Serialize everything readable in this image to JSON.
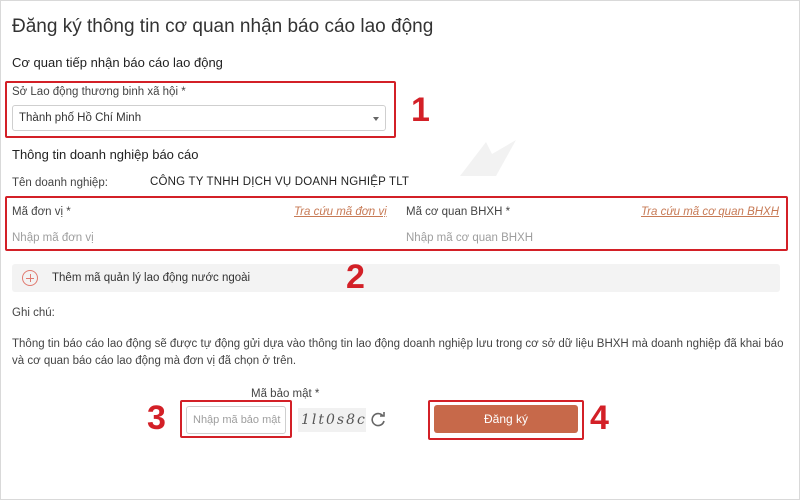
{
  "page": {
    "title": "Đăng ký thông tin cơ quan nhận báo cáo lao động"
  },
  "receiving_agency": {
    "section_title": "Cơ quan tiếp nhận báo cáo lao động",
    "field_label": "Sở Lao động thương binh xã hội *",
    "selected_value": "Thành phố Hồ Chí Minh"
  },
  "enterprise": {
    "section_title": "Thông tin doanh nghiệp báo cáo",
    "name_label": "Tên doanh nghiệp:",
    "name_value": "CÔNG TY TNHH DỊCH VỤ DOANH NGHIỆP TLT",
    "unit_code_label": "Mã đơn vị *",
    "unit_code_link": "Tra cứu mã đơn vị",
    "unit_code_placeholder": "Nhập mã đơn vị",
    "bhxh_code_label": "Mã cơ quan BHXH *",
    "bhxh_code_link": "Tra cứu mã cơ quan BHXH",
    "bhxh_code_placeholder": "Nhập mã cơ quan BHXH",
    "add_foreign_label": "Thêm mã quản lý lao động nước ngoài"
  },
  "note": {
    "title": "Ghi chú:",
    "text": "Thông tin báo cáo lao động sẽ được tự động gửi dựa vào thông tin lao động doanh nghiệp lưu trong cơ sở dữ liệu BHXH mà doanh nghiệp đã khai báo và cơ quan báo cáo lao động mà đơn vị đã chọn ở trên."
  },
  "captcha": {
    "label": "Mã bảo mật *",
    "placeholder": "Nhập mã bảo mật",
    "image_text": "1lt0s8c"
  },
  "submit": {
    "label": "Đăng ký"
  },
  "annotations": {
    "step1": "1",
    "step2": "2",
    "step3": "3",
    "step4": "4",
    "color": "#d32027"
  },
  "colors": {
    "accent": "#c7694a",
    "link": "#c77a55",
    "highlight": "#d32027"
  }
}
